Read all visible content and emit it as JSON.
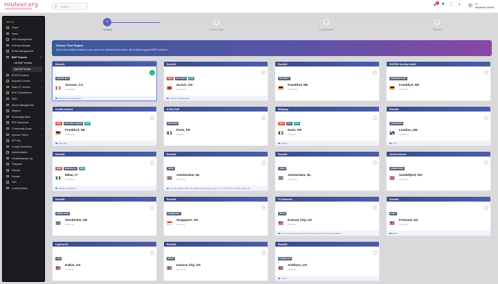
{
  "brand": {
    "logo": "routeur.org"
  },
  "search": {
    "placeholder": "Search..."
  },
  "topbar": {
    "notif_count": "1",
    "user_greeting": "Hi",
    "user_name": "Sebastian Sheetz"
  },
  "sidebar": {
    "heading": "MENU",
    "items": [
      {
        "label": "Home"
      },
      {
        "label": "News"
      },
      {
        "label": "ASN Management"
      },
      {
        "label": "Peering Manager"
      },
      {
        "label": "Prefix Management"
      },
      {
        "label": "BGP Tunnels"
      },
      {
        "label": "BYOIP Prefixes"
      },
      {
        "label": "Anycast Tunnels"
      },
      {
        "label": "Static IP Tunnels"
      },
      {
        "label": "IPv6 Tunnelbroker"
      },
      {
        "label": "DNS"
      },
      {
        "label": "Abuse Management"
      },
      {
        "label": "Support"
      },
      {
        "label": "Knowledge Base"
      },
      {
        "label": "IRR Resources"
      },
      {
        "label": "Community Goals"
      },
      {
        "label": "Sponsor Token"
      },
      {
        "label": "API Key"
      },
      {
        "label": "Config Generators"
      },
      {
        "label": "Administration"
      },
      {
        "label": "Housekeeping Log"
      },
      {
        "label": "Telegram"
      },
      {
        "label": "Discord"
      },
      {
        "label": "Donate"
      },
      {
        "label": "TAS"
      },
      {
        "label": "Looking Glass"
      }
    ],
    "subitems": [
      {
        "label": "List BGP Tunnels"
      },
      {
        "label": "Add BGP tunnel"
      }
    ]
  },
  "stepper": {
    "steps": [
      {
        "num": "1",
        "label": "Location"
      },
      {
        "num": "2",
        "label": "Tunnel Type"
      },
      {
        "num": "3",
        "label": "Configuration"
      },
      {
        "num": "4",
        "label": "Review"
      }
    ]
  },
  "banner": {
    "title": "Choose Your Region",
    "text": "Select the location closest to your server for optimal performance. All locations support BGP sessions."
  },
  "cards": [
    {
      "provider": "Route64",
      "tags": [
        "GEOIP64 IPV4"
      ],
      "city": "Toronto, CA",
      "sub": "13 ms/s/ok",
      "footer": "Ontario Internet Exchange",
      "flag": "f-ca"
    },
    {
      "provider": "Route64",
      "tags": [
        "NEW",
        "IPV4 UPRS",
        "IPV6"
      ],
      "city": "Zurich, CH",
      "sub": "14 ms/s ok",
      "footer": "Interxion, Digital Realty",
      "flag": "f-ch"
    },
    {
      "provider": "Route64",
      "tags": [
        "IPV4 BRUT"
      ],
      "city": "Frankfurt, DE",
      "sub": "11 this ms",
      "footer": "",
      "flag": "f-de"
    },
    {
      "provider": "EXEVEN DevOps GmbH",
      "tags": [
        "FRANKFURT-FRA"
      ],
      "city": "Frankfurt, DE",
      "sub": "11 this ms",
      "footer": "",
      "flag": "f-de"
    },
    {
      "provider": "Gen6io.network",
      "tags": [
        "NEW",
        "IPV4 UPRS, GEOIP6",
        "IPV6"
      ],
      "city": "Frankfurt, DE",
      "sub": "13 this ms",
      "footer": "NIAN-HIS",
      "flag": "f-de"
    },
    {
      "provider": "DYDIX SAS",
      "tags": [
        "ESS PROS"
      ],
      "city": "Paris, FR",
      "sub": "13 pps fr",
      "footer": "",
      "flag": "f-fr"
    },
    {
      "provider": "Milkyway",
      "tags": [
        "NEW",
        "IPV4",
        "IPV6"
      ],
      "city": "Paris, FR",
      "sub": "13 pps fr",
      "footer": "RIMS IX",
      "flag": "f-fr"
    },
    {
      "provider": "Route64",
      "tags": [
        "TELEHOUSE"
      ],
      "city": "London, GB",
      "sub": "13 this ms",
      "footer": "LINX",
      "flag": "f-gb"
    },
    {
      "provider": "Route64",
      "tags": [
        "NEW",
        "GEOIP64 ALL",
        "IPV6"
      ],
      "city": "Milan, IT",
      "sub": "13 mngs ft",
      "footer": "MINAN INTERNE IX",
      "flag": "f-it"
    },
    {
      "provider": "Route64",
      "tags": [
        "AMSIX"
      ],
      "city": "Amsterdam, NL",
      "sub": "13 ams nl",
      "footer": "2-10 Ge, AMS-IX, DE-CIX, Digital Realty (Equinix, Frys IX, NL-IX, PFTIX-IX, Other, Speed-IX)",
      "flag": "f-nl"
    },
    {
      "provider": "Route64",
      "tags": [
        "AMSIX"
      ],
      "city": "Amsterdam, NL",
      "sub": "13 ams nl",
      "footer": "",
      "flag": "f-nl"
    },
    {
      "provider": "Yuexik Internet",
      "tags": [
        "SANDEFJORD"
      ],
      "city": "Sandefjord, NO",
      "sub": "13 san no",
      "footer": "",
      "flag": "f-no"
    },
    {
      "provider": "Route64",
      "tags": [
        "SWENT SAFE"
      ],
      "city": "Stockholm, SE",
      "sub": "13 sto se",
      "footer": "",
      "flag": "f-se"
    },
    {
      "provider": "Route64",
      "tags": [
        "EQUINIX SG1"
      ],
      "city": "Singapore, SG",
      "sub": "13 sin sg",
      "footer": "",
      "flag": "f-sg"
    },
    {
      "provider": "FV Networks",
      "tags": [
        "MKCIX"
      ],
      "city": "Kansas City, US",
      "sub": "13 mci us",
      "footer": "FCIX, Great Plains Internet IX, DE-CIX Kansas, KC Kansas Intlinktion",
      "flag": "f-us"
    },
    {
      "provider": "Route64",
      "tags": [
        "FMT2"
      ],
      "city": "Fremont, US",
      "sub": "13 fmt us",
      "footer": "FMIX",
      "flag": "f-us"
    },
    {
      "provider": "Logicrw.US",
      "tags": [
        "AXE"
      ],
      "city": "Dallas, US",
      "sub": "13 dal us",
      "footer": "",
      "flag": "f-us"
    },
    {
      "provider": "Route64",
      "tags": [
        "MKCIX"
      ],
      "city": "Kansas City, US",
      "sub": "13 mci us",
      "footer": "",
      "flag": "f-us"
    },
    {
      "provider": "Route64",
      "tags": [
        "EQUINIX AS3"
      ],
      "city": "Ashburn, US",
      "sub": "13 iad us",
      "footer": "NOVA",
      "flag": "f-us"
    }
  ]
}
